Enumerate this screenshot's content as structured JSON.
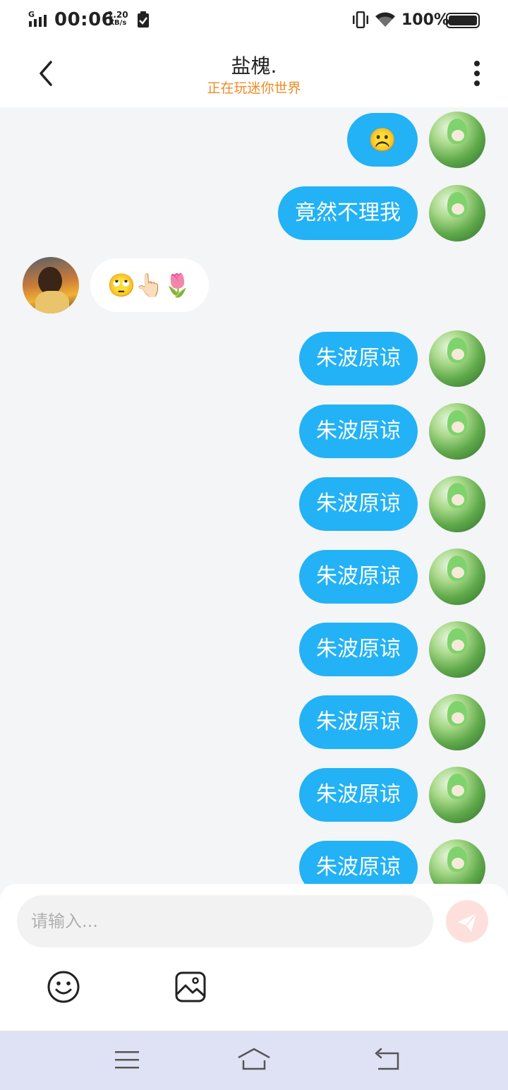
{
  "status_bar": {
    "network": "G",
    "time": "00:06",
    "speed_value": "1.20",
    "speed_unit": "KB/s",
    "battery": "100%"
  },
  "header": {
    "title": "盐槐.",
    "subtitle": "正在玩迷你世界"
  },
  "messages": [
    {
      "from": "me",
      "text": "☹️"
    },
    {
      "from": "me",
      "text": "竟然不理我"
    },
    {
      "from": "other",
      "text": "🙄👆🏻🌷"
    },
    {
      "from": "me",
      "text": "朱波原谅"
    },
    {
      "from": "me",
      "text": "朱波原谅"
    },
    {
      "from": "me",
      "text": "朱波原谅"
    },
    {
      "from": "me",
      "text": "朱波原谅"
    },
    {
      "from": "me",
      "text": "朱波原谅"
    },
    {
      "from": "me",
      "text": "朱波原谅"
    },
    {
      "from": "me",
      "text": "朱波原谅"
    },
    {
      "from": "me",
      "text": "朱波原谅"
    }
  ],
  "input": {
    "placeholder": "请输入..."
  },
  "colors": {
    "bubble_me": "#22b2f5",
    "subtitle": "#f08a24",
    "send_button": "#fde0dc"
  },
  "icons": {
    "back": "chevron-left-icon",
    "more": "more-vertical-icon",
    "send": "paper-plane-icon",
    "emoji": "smile-icon",
    "image": "image-icon"
  }
}
